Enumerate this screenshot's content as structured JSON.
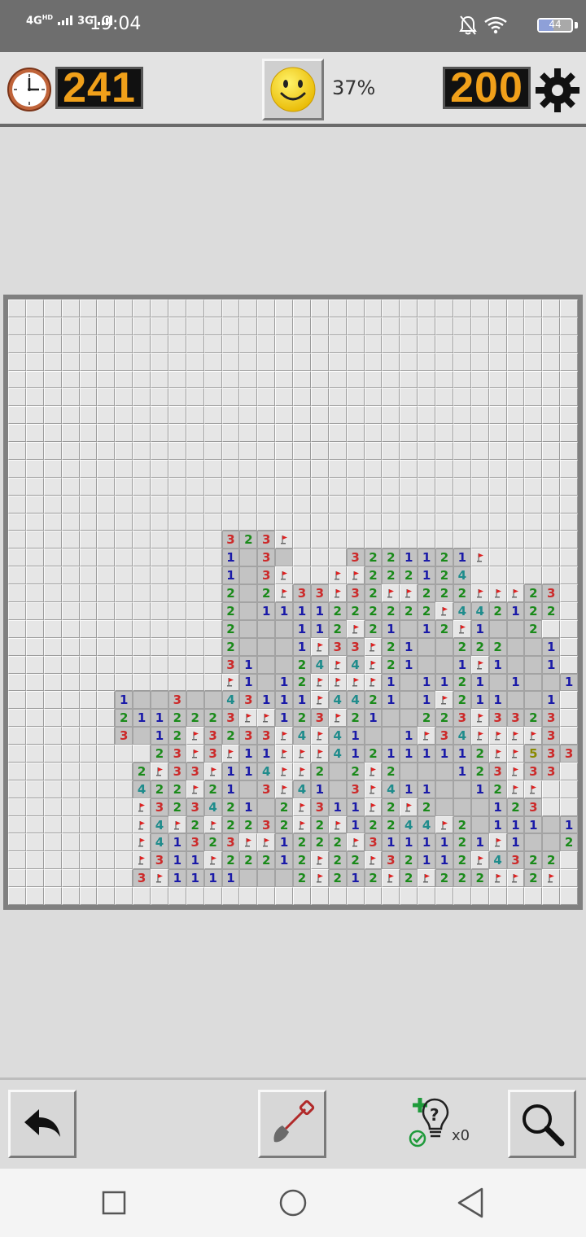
{
  "status_bar": {
    "network_1": "4G",
    "network_1_suffix": "HD",
    "network_2": "3G",
    "time": "19:04",
    "battery": "44",
    "icons": [
      "bell-off-icon",
      "wifi-icon",
      "battery-icon"
    ]
  },
  "game": {
    "elapsed_time": "241",
    "progress": "37%",
    "mines_remaining": "200",
    "smiley_state": "happy",
    "hint_count": "x0"
  },
  "board": {
    "cols": 32,
    "rows": 34,
    "legend": {
      "#": "unrevealed cell",
      ".": "revealed empty",
      "F": "flagged cell",
      "1-8": "revealed number"
    },
    "colors": {
      "1": "#1a1aa8",
      "2": "#1a8a1a",
      "3": "#cc2a2a",
      "4": "#1f8c8c",
      "5": "#8a8a00"
    },
    "cells": [
      "################################",
      "################################",
      "################################",
      "################################",
      "################################",
      "################################",
      "################################",
      "################################",
      "################################",
      "################################",
      "################################",
      "################################",
      "################################",
      "############323F################",
      "############1.3.###3221121F#####",
      "############1.3F##FF222124######",
      "############2.2F33F32FF222FFF23#",
      "############2.1111222222F442122#",
      "############2...112F21.12F1..2#",
      "############2...1F33F21..222..1#",
      "############31..24F4F21..1F1..1#",
      "############F1.12FFFF1.1121 1..1#",
      "######1..3..43111F4421.1F211..1#",
      "######2112223FF123F21..223F3323#",
      "######3.12F3233F4F41..1F34FFFF3#",
      "########23F3F11FFF412111112FF533#",
      "#######2F33F114FF2.2F2...123F33#",
      "#######422F21.3F41.3F411..12FF#",
      "#######F323421.2F311F2F2...123#",
      "#######F4F2F2232F2F12244F2.111.1#",
      "#######F41323FF1222F3111121F1..2#",
      "#######F311F22212F22F32112F4322#",
      "#######3F1111...2F212F2F222FF2F#",
      "################################"
    ]
  },
  "toolbar": {
    "undo": "undo-icon",
    "dig": "shovel-icon",
    "hint": "hint-bulb-icon",
    "search": "magnifier-icon"
  },
  "nav": {
    "recent": "square-icon",
    "home": "circle-icon",
    "back": "triangle-back-icon"
  }
}
